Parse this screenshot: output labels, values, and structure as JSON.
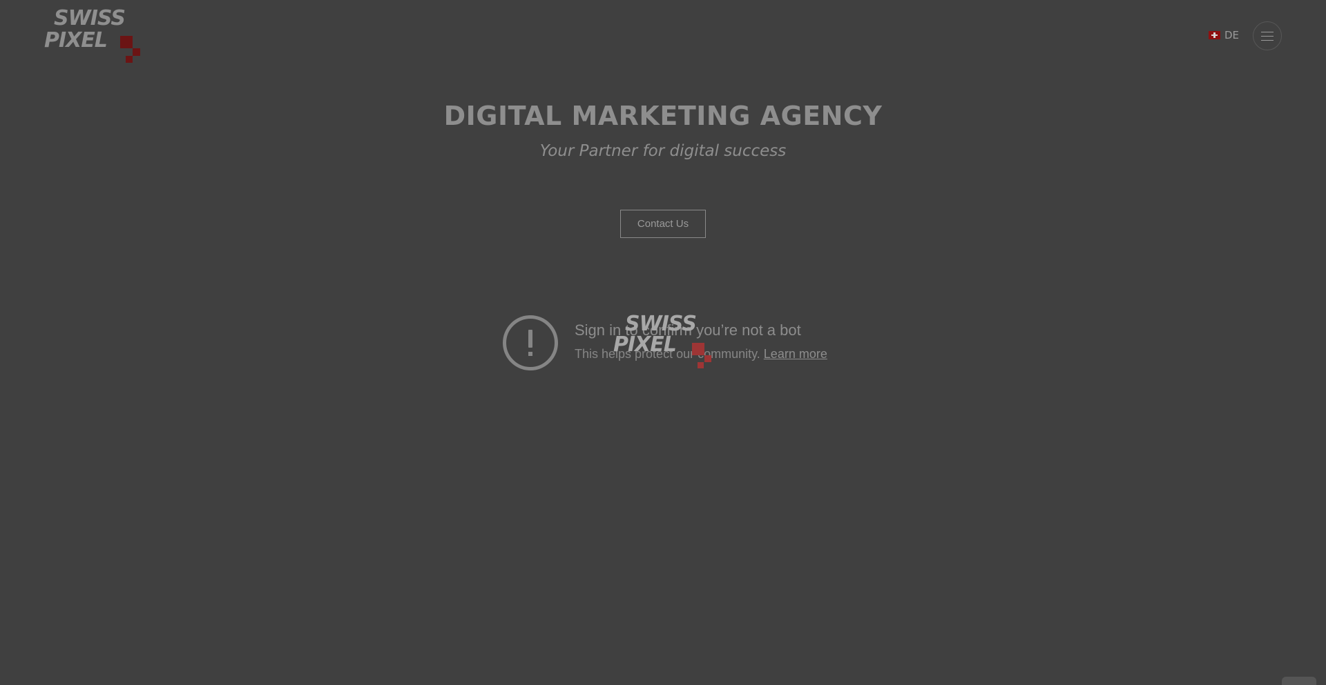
{
  "header": {
    "logo_line1": "SWISS",
    "logo_line2": "PIXEL",
    "language": "DE",
    "menu_icon": "hamburger-menu-icon",
    "flag_icon": "swiss-flag-icon"
  },
  "hero": {
    "title": "DIGITAL MARKETING AGENCY",
    "subtitle": "Your Partner for digital success",
    "cta_label": "Contact Us"
  },
  "notice": {
    "icon": "exclamation-circle-icon",
    "title": "Sign in to confirm you’re not a bot",
    "text": "This helps protect our community.",
    "link": "Learn more"
  },
  "loader_logo": {
    "line1": "SWISS",
    "line2": "PIXEL"
  },
  "colors": {
    "background": "#404040",
    "accent": "#6b1414"
  }
}
